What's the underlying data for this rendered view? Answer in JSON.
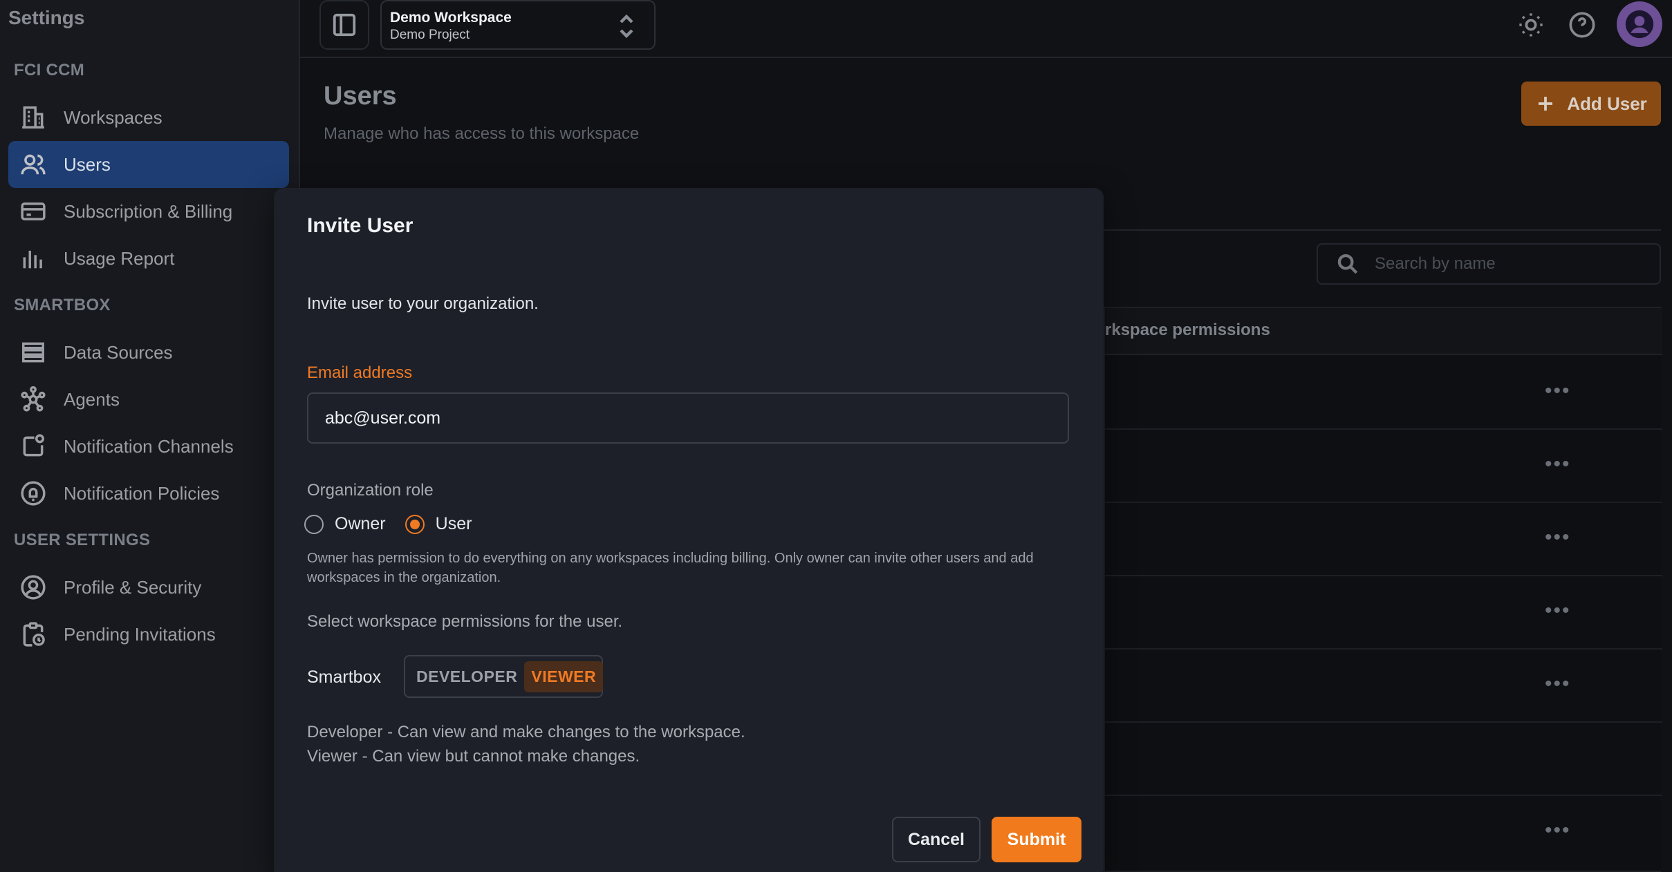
{
  "sidebar": {
    "title": "Settings",
    "sections": [
      {
        "title": "FCI CCM",
        "items": [
          {
            "label": "Workspaces",
            "icon": "building-icon"
          },
          {
            "label": "Users",
            "icon": "users-icon",
            "active": true
          },
          {
            "label": "Subscription & Billing",
            "icon": "credit-card-icon"
          },
          {
            "label": "Usage Report",
            "icon": "bar-chart-icon"
          }
        ]
      },
      {
        "title": "SMARTBOX",
        "items": [
          {
            "label": "Data Sources",
            "icon": "server-icon"
          },
          {
            "label": "Agents",
            "icon": "agents-hub-icon"
          },
          {
            "label": "Notification Channels",
            "icon": "notification-channel-icon"
          },
          {
            "label": "Notification Policies",
            "icon": "bell-shield-icon"
          }
        ]
      },
      {
        "title": "USER SETTINGS",
        "items": [
          {
            "label": "Profile & Security",
            "icon": "user-circle-icon"
          },
          {
            "label": "Pending Invitations",
            "icon": "clipboard-clock-icon"
          }
        ]
      }
    ]
  },
  "topbar": {
    "workspace_name": "Demo Workspace",
    "project_name": "Demo Project",
    "icons": [
      "sidebar-toggle-icon",
      "sun-icon",
      "help-icon",
      "avatar-icon"
    ]
  },
  "main": {
    "title": "Users",
    "subtitle": "Manage who has access to this workspace",
    "add_user_label": "Add User",
    "search_placeholder": "Search by name",
    "table_header_visible": "rkspace permissions",
    "row_action_label": "•••"
  },
  "modal": {
    "title": "Invite User",
    "description": "Invite user to your organization.",
    "email_label": "Email address",
    "email_value": "abc@user.com",
    "role_label": "Organization role",
    "roles": [
      {
        "label": "Owner",
        "checked": false
      },
      {
        "label": "User",
        "checked": true
      }
    ],
    "role_help": "Owner has permission to do everything on any workspaces including billing. Only owner can invite other users and add workspaces in the organization.",
    "permissions_label": "Select workspace permissions for the user.",
    "smartbox_label": "Smartbox",
    "permission_options": [
      {
        "label": "DEVELOPER",
        "selected": false
      },
      {
        "label": "VIEWER",
        "selected": true
      }
    ],
    "developer_help": "Developer - Can view and make changes to the workspace.",
    "viewer_help": "Viewer - Can view but cannot make changes.",
    "cancel_label": "Cancel",
    "submit_label": "Submit"
  },
  "colors": {
    "accent": "#f07a1c",
    "active_nav": "#1e3f78",
    "modal_bg": "#1d2028",
    "page_bg": "#0f1115"
  }
}
